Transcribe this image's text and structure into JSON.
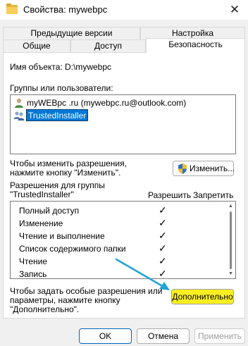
{
  "window": {
    "title": "Свойства: mywebpc",
    "close_glyph": "✕"
  },
  "tabs": {
    "row1": [
      "Предыдущие версии",
      "Настройка"
    ],
    "row2": [
      "Общие",
      "Доступ",
      "Безопасность"
    ],
    "active": "Безопасность"
  },
  "security": {
    "object_name_label": "Имя объекта:",
    "object_name_value": "D:\\mywebpc",
    "groups_label": "Группы или пользователи:",
    "groups": [
      {
        "name": "myWEBpc .ru (mywebpc.ru@outlook.com)",
        "icon": "user-icon",
        "selected": false
      },
      {
        "name": "TrustedInstaller",
        "icon": "users-icon",
        "selected": true
      }
    ],
    "change_hint_line1": "Чтобы изменить разрешения,",
    "change_hint_line2": "нажмите кнопку \"Изменить\".",
    "change_button": "Изменить...",
    "perm_for_line1": "Разрешения для группы",
    "perm_for_line2": "\"TrustedInstaller\"",
    "col_allow": "Разрешить",
    "col_deny": "Запретить",
    "permissions": [
      {
        "name": "Полный доступ",
        "allow": "✓",
        "deny": ""
      },
      {
        "name": "Изменение",
        "allow": "✓",
        "deny": ""
      },
      {
        "name": "Чтение и выполнение",
        "allow": "✓",
        "deny": ""
      },
      {
        "name": "Список содержимого папки",
        "allow": "✓",
        "deny": ""
      },
      {
        "name": "Чтение",
        "allow": "✓",
        "deny": ""
      },
      {
        "name": "Запись",
        "allow": "✓",
        "deny": ""
      }
    ],
    "special_hint_line1": "Чтобы задать особые разрешения или",
    "special_hint_line2": "параметры, нажмите кнопку",
    "special_hint_line3": "\"Дополнительно\".",
    "advanced_button": "Дополнительно",
    "advanced_highlight_color": "#fbef22",
    "annotation_arrow_color": "#1ea3d6"
  },
  "footer": {
    "ok": "OK",
    "cancel": "Отмена",
    "apply": "Применить"
  }
}
